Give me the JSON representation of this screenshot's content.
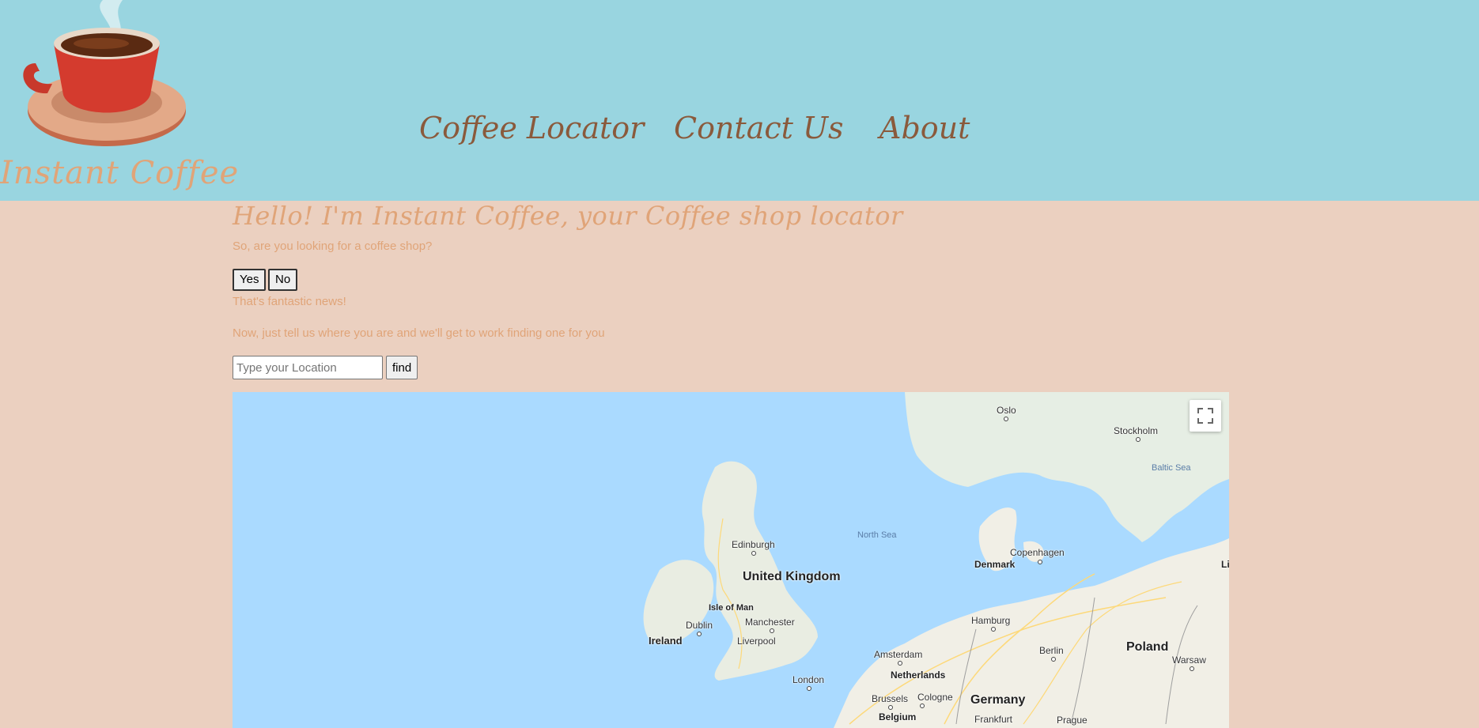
{
  "header": {
    "brand": "Instant Coffee",
    "logo_icon": "coffee-cup-icon",
    "nav": [
      {
        "label": "Coffee Locator"
      },
      {
        "label": "Contact Us"
      },
      {
        "label": "About"
      }
    ]
  },
  "content": {
    "greeting": "Hello! I'm Instant Coffee, your Coffee shop locator",
    "question": "So, are you looking for a coffee shop?",
    "yes_label": "Yes",
    "no_label": "No",
    "response": "That's fantastic news!",
    "instruction": "Now, just tell us where you are and we'll get to work finding one for you",
    "location_placeholder": "Type your Location",
    "location_value": "",
    "find_label": "find"
  },
  "map": {
    "fullscreen_icon": "fullscreen-icon",
    "seas": [
      "North Sea",
      "Baltic Sea"
    ],
    "countries": [
      "United Kingdom",
      "Ireland",
      "Denmark",
      "Netherlands",
      "Belgium",
      "Germany",
      "Poland"
    ],
    "cities": [
      "Oslo",
      "Stockholm",
      "Edinburgh",
      "Copenhagen",
      "Isle of Man",
      "Dublin",
      "Manchester",
      "Liverpool",
      "Hamburg",
      "Berlin",
      "Amsterdam",
      "Warsaw",
      "London",
      "Brussels",
      "Cologne",
      "Frankfurt",
      "Prague",
      "Li"
    ]
  },
  "colors": {
    "header_bg": "#99d5e0",
    "page_bg": "#ebd0c0",
    "accent": "#e0a478",
    "nav_text": "#8a5a3c",
    "water": "#aadaff"
  }
}
